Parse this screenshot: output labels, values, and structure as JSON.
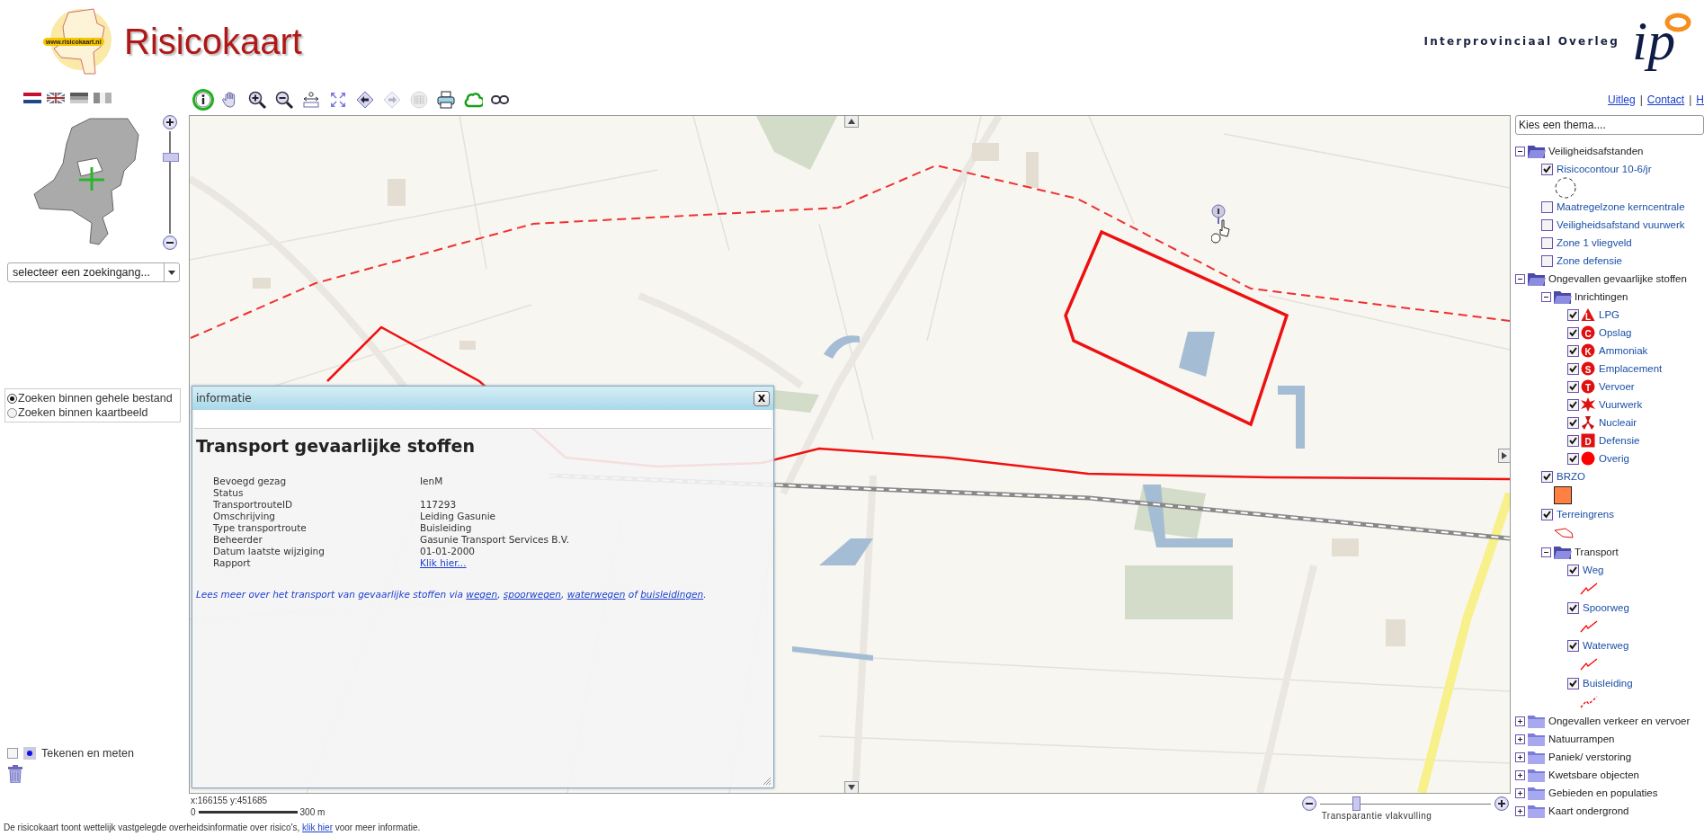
{
  "header": {
    "logo_text": "www.risicokaart.nl",
    "title": "Risicokaart",
    "partner": "Interprovinciaal Overleg",
    "partner_logo": "ip"
  },
  "languages": [
    {
      "kind": "nl",
      "disabled": false
    },
    {
      "kind": "uk",
      "disabled": false
    },
    {
      "kind": "de",
      "disabled": true
    },
    {
      "kind": "fr",
      "disabled": true
    }
  ],
  "toolbar": [
    {
      "kind": "info",
      "selected": true,
      "disabled": false
    },
    {
      "kind": "pan",
      "selected": false,
      "disabled": false
    },
    {
      "kind": "zoom-in",
      "selected": false,
      "disabled": false
    },
    {
      "kind": "zoom-out",
      "selected": false,
      "disabled": false
    },
    {
      "kind": "measure",
      "selected": false,
      "disabled": false
    },
    {
      "kind": "full-extent",
      "selected": false,
      "disabled": false
    },
    {
      "kind": "back",
      "selected": false,
      "disabled": false
    },
    {
      "kind": "forward",
      "selected": false,
      "disabled": true
    },
    {
      "kind": "table",
      "selected": false,
      "disabled": true
    },
    {
      "kind": "print",
      "selected": false,
      "disabled": false
    },
    {
      "kind": "cloud",
      "selected": false,
      "disabled": false
    },
    {
      "kind": "link",
      "selected": false,
      "disabled": false
    }
  ],
  "links": [
    {
      "kind": "link",
      "text": "Uitleg"
    },
    {
      "kind": "separator",
      "text": "|"
    },
    {
      "kind": "link",
      "text": "Contact"
    },
    {
      "kind": "separator",
      "text": "|"
    },
    {
      "kind": "link",
      "text": "H"
    }
  ],
  "zoom_slider": {
    "level": 0.75
  },
  "search": {
    "placeholder": "selecteer  een zoekingang..."
  },
  "search_scope": [
    {
      "label": "Zoeken binnen gehele bestand",
      "selected": true
    },
    {
      "label": "Zoeken binnen kaartbeeld",
      "selected": false
    }
  ],
  "drawing_tools": {
    "label": "Tekenen en meten",
    "checked": false
  },
  "info_window": {
    "title": "informatie",
    "close": "X",
    "heading": "Transport gevaarlijke stoffen",
    "rows": [
      {
        "key": "Bevoegd gezag",
        "value": "IenM"
      },
      {
        "key": "Status"
      },
      {
        "key": "TransportrouteID",
        "value": "117293"
      },
      {
        "key": "Omschrijving",
        "value": "Leiding Gasunie"
      },
      {
        "key": "Type transportroute",
        "value": "Buisleiding"
      },
      {
        "key": "Beheerder",
        "value": "Gasunie Transport Services B.V."
      },
      {
        "key": "Datum laatste wijziging",
        "value": "01-01-2000"
      },
      {
        "key": "Rapport",
        "link": "Klik hier..."
      }
    ],
    "note": [
      {
        "text": "Lees meer over het transport van gevaarlijke stoffen via "
      },
      {
        "link": "wegen"
      },
      {
        "text": ", "
      },
      {
        "link": "spoorwegen"
      },
      {
        "text": ", "
      },
      {
        "link": "waterwegen"
      },
      {
        "text": " of "
      },
      {
        "link": "buisleidingen"
      },
      {
        "text": "."
      }
    ]
  },
  "status": {
    "coordinates": "x:166155 y:451685",
    "scale_start": "0",
    "scale_end": "300 m"
  },
  "transparency": {
    "label": "Transparantie vlakvulling",
    "level": 0.21
  },
  "theme_select": {
    "placeholder": "Kies een thema...."
  },
  "layers": [
    {
      "kind": "group",
      "label": "Veiligheidsafstanden",
      "expanded": true,
      "children": [
        {
          "kind": "layer",
          "label": "Risicocontour 10-6/jr",
          "checked": true,
          "legend": {
            "kind": "dashed-circle"
          }
        },
        {
          "kind": "layer",
          "label": "Maatregelzone kerncentrale",
          "checked": false
        },
        {
          "kind": "layer",
          "label": "Veiligheidsafstand vuurwerk",
          "checked": false
        },
        {
          "kind": "layer",
          "label": "Zone 1 vliegveld",
          "checked": false
        },
        {
          "kind": "layer",
          "label": "Zone defensie",
          "checked": false
        }
      ]
    },
    {
      "kind": "group",
      "label": "Ongevallen gevaarlijke stoffen",
      "expanded": true,
      "children": [
        {
          "kind": "group",
          "label": "Inrichtingen",
          "expanded": true,
          "children": [
            {
              "kind": "layer",
              "label": "LPG",
              "checked": true,
              "marker": {
                "kind": "triangle",
                "letter": "L"
              }
            },
            {
              "kind": "layer",
              "label": "Opslag",
              "checked": true,
              "marker": {
                "kind": "circle",
                "letter": "C"
              }
            },
            {
              "kind": "layer",
              "label": "Ammoniak",
              "checked": true,
              "marker": {
                "kind": "circle",
                "letter": "K"
              }
            },
            {
              "kind": "layer",
              "label": "Emplacement",
              "checked": true,
              "marker": {
                "kind": "circle",
                "letter": "S"
              }
            },
            {
              "kind": "layer",
              "label": "Vervoer",
              "checked": true,
              "marker": {
                "kind": "circle",
                "letter": "T"
              }
            },
            {
              "kind": "layer",
              "label": "Vuurwerk",
              "checked": true,
              "marker": {
                "kind": "burst"
              }
            },
            {
              "kind": "layer",
              "label": "Nucleair",
              "checked": true,
              "marker": {
                "kind": "trefoil"
              }
            },
            {
              "kind": "layer",
              "label": "Defensie",
              "checked": true,
              "marker": {
                "kind": "square",
                "letter": "D"
              }
            },
            {
              "kind": "layer",
              "label": "Overig",
              "checked": true,
              "marker": {
                "kind": "dot"
              }
            }
          ]
        },
        {
          "kind": "layer",
          "label": "BRZO",
          "checked": true,
          "legend": {
            "kind": "swatch"
          }
        },
        {
          "kind": "layer",
          "label": "Terreingrens",
          "checked": true,
          "legend": {
            "kind": "outline"
          }
        },
        {
          "kind": "group",
          "label": "Transport",
          "expanded": true,
          "children": [
            {
              "kind": "layer",
              "label": "Weg",
              "checked": true,
              "legend": {
                "kind": "line"
              }
            },
            {
              "kind": "layer",
              "label": "Spoorweg",
              "checked": true,
              "legend": {
                "kind": "line"
              }
            },
            {
              "kind": "layer",
              "label": "Waterweg",
              "checked": true,
              "legend": {
                "kind": "line"
              }
            },
            {
              "kind": "layer",
              "label": "Buisleiding",
              "checked": true,
              "legend": {
                "kind": "dashed-line"
              }
            }
          ]
        }
      ]
    },
    {
      "kind": "group",
      "label": "Ongevallen verkeer en vervoer",
      "expanded": false
    },
    {
      "kind": "group",
      "label": "Natuurrampen",
      "expanded": false
    },
    {
      "kind": "group",
      "label": "Paniek/ verstoring",
      "expanded": false
    },
    {
      "kind": "group",
      "label": "Kwetsbare objecten",
      "expanded": false
    },
    {
      "kind": "group",
      "label": "Gebieden en populaties",
      "expanded": false
    },
    {
      "kind": "group",
      "label": "Kaart ondergrond",
      "expanded": false
    }
  ],
  "footer": [
    {
      "text": "De risicokaart toont wettelijk vastgelegde overheidsinformatie over risico's, "
    },
    {
      "link": "klik hier"
    },
    {
      "text": " voor meer informatie."
    }
  ]
}
